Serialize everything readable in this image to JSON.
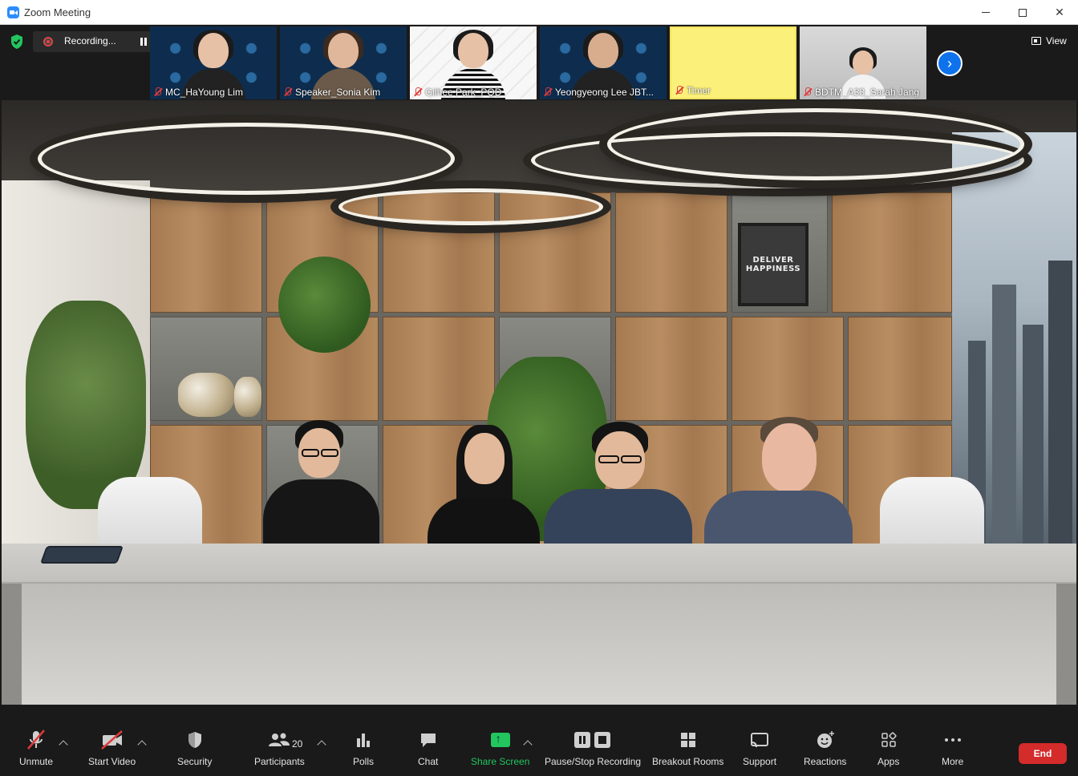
{
  "window": {
    "title": "Zoom Meeting"
  },
  "recording": {
    "label": "Recording..."
  },
  "view_button": {
    "label": "View"
  },
  "participants_strip": [
    {
      "name": "MC_HaYoung Lim",
      "bg": "district"
    },
    {
      "name": "Speaker_Sonia Kim",
      "bg": "district"
    },
    {
      "name": "Gilhee Park_PQD",
      "bg": "white"
    },
    {
      "name": "Yeongyeong Lee JBT...",
      "bg": "district"
    },
    {
      "name": "Timer",
      "bg": "yellow"
    },
    {
      "name": "BDTM_A33_Sarah Jang",
      "bg": "office"
    }
  ],
  "poster": {
    "line1": "DELIVER",
    "line2": "HAPPINESS"
  },
  "toolbar": {
    "unmute": "Unmute",
    "start_video": "Start Video",
    "security": "Security",
    "participants": "Participants",
    "participants_count": "20",
    "polls": "Polls",
    "chat": "Chat",
    "share_screen": "Share Screen",
    "pause_stop_recording": "Pause/Stop Recording",
    "breakout_rooms": "Breakout Rooms",
    "support": "Support",
    "reactions": "Reactions",
    "apps": "Apps",
    "more": "More",
    "end": "End"
  },
  "colors": {
    "accent": "#0e72ed",
    "share_green": "#22c55e",
    "end_red": "#d42b2b"
  }
}
